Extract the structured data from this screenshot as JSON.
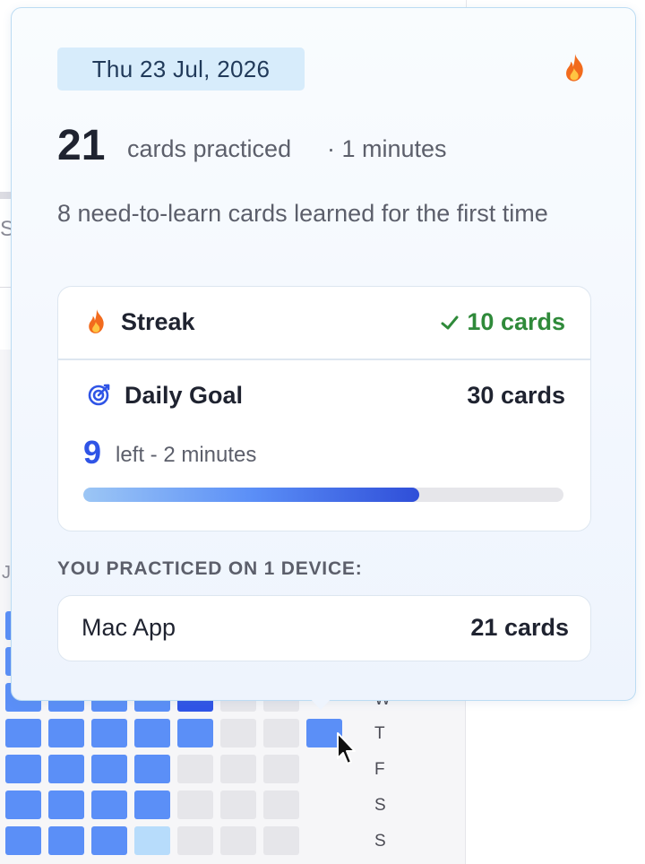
{
  "tooltip": {
    "date": "Thu 23 Jul, 2026",
    "cards_count": "21",
    "cards_label": "cards practiced",
    "minutes_label": "· 1 minutes",
    "learned_text": "8 need-to-learn cards learned for the first time",
    "streak": {
      "label": "Streak",
      "value": "10 cards",
      "status": "completed"
    },
    "daily_goal": {
      "label": "Daily Goal",
      "value": "30 cards",
      "left_count": "9",
      "left_text": "left - 2 minutes",
      "progress": 0.7
    },
    "devices_heading": "YOU PRACTICED ON 1 DEVICE:",
    "devices": [
      {
        "name": "Mac App",
        "count": "21 cards"
      }
    ]
  },
  "background": {
    "partial_letters": [
      "S",
      "J"
    ],
    "weekday_labels": [
      "W",
      "T",
      "F",
      "S",
      "S"
    ]
  },
  "colors": {
    "accent_blue": "#2f54e6",
    "heatmap_blue": "#5b8ff7",
    "heatmap_light": "#b7dcfb",
    "heatmap_empty": "#e6e6ea",
    "streak_green": "#2f8a3a",
    "flame": "#f26b1d"
  },
  "icons": {
    "date_badge_icon": "fire-icon",
    "streak_icon": "fire-icon",
    "streak_status_icon": "check-icon",
    "goal_icon": "target-icon"
  }
}
